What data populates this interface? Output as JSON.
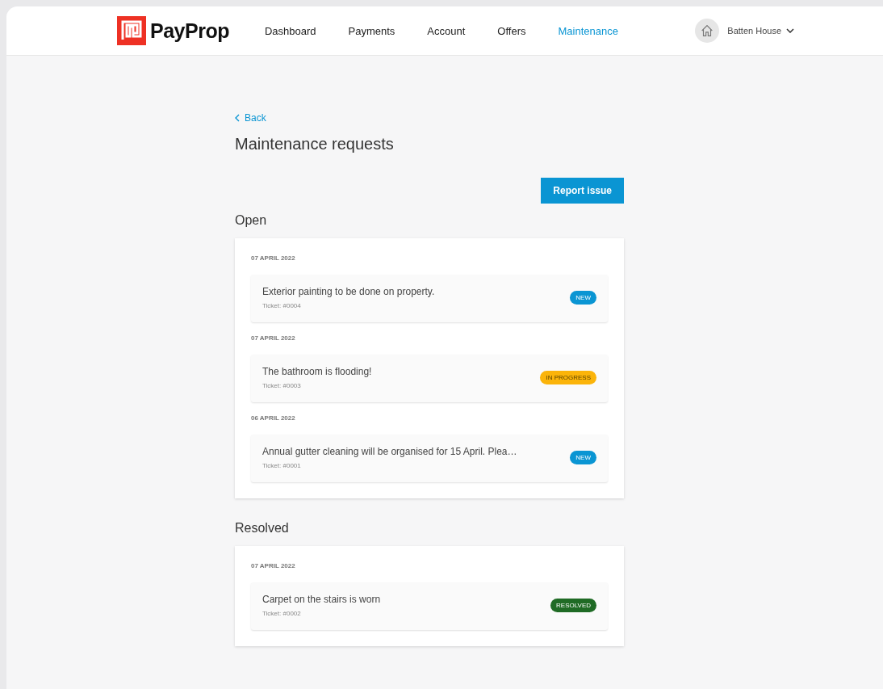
{
  "header": {
    "logo": "PayProp",
    "nav": [
      {
        "label": "Dashboard",
        "selected": false
      },
      {
        "label": "Payments",
        "selected": false
      },
      {
        "label": "Account",
        "selected": false
      },
      {
        "label": "Offers",
        "selected": false
      },
      {
        "label": "Maintenance",
        "selected": true
      }
    ],
    "property": "Batten House"
  },
  "back": "Back",
  "title": "Maintenance requests",
  "report_button": "Report issue",
  "sections": [
    {
      "heading": "Open",
      "groups": [
        {
          "date": "07 APRIL 2022",
          "items": [
            {
              "text": "Exterior painting to be done on property.",
              "ticket": "Ticket: #0004",
              "status": "NEW",
              "color": "#0a95d3"
            }
          ]
        },
        {
          "date": "07 APRIL 2022",
          "items": [
            {
              "text": "The bathroom is flooding!",
              "ticket": "Ticket: #0003",
              "status": "IN PROGRESS",
              "color": "#fbb40a"
            }
          ]
        },
        {
          "date": "06 APRIL 2022",
          "items": [
            {
              "text": "Annual gutter cleaning will be organised for 15 April. Plea…",
              "ticket": "Ticket: #0001",
              "status": "NEW",
              "color": "#0a95d3"
            }
          ]
        }
      ]
    },
    {
      "heading": "Resolved",
      "groups": [
        {
          "date": "07 APRIL 2022",
          "items": [
            {
              "text": "Carpet on the stairs is worn",
              "ticket": "Ticket: #0002",
              "status": "RESOLVED",
              "color": "#1f6b25"
            }
          ]
        }
      ]
    }
  ]
}
